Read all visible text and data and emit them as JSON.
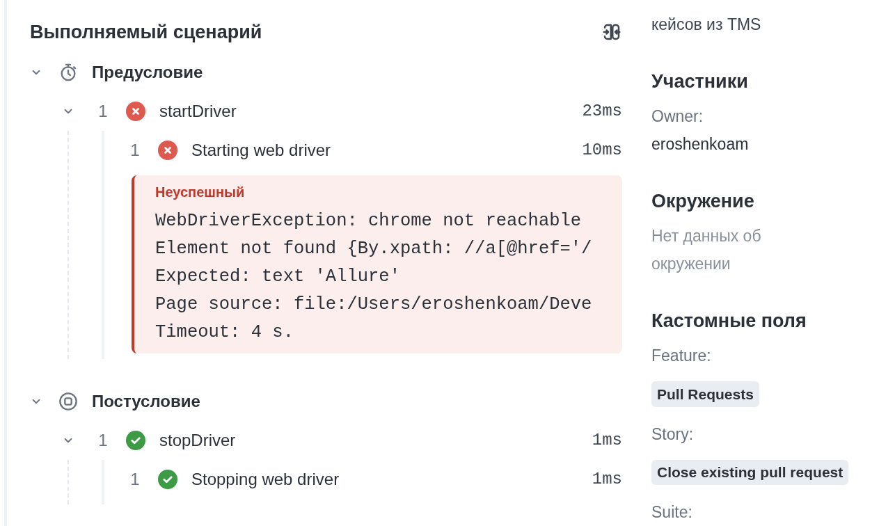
{
  "scenario": {
    "title": "Выполняемый сценарий",
    "sections": [
      {
        "kind": "setup",
        "label": "Предусловие",
        "expanded": true,
        "steps": [
          {
            "number": "1",
            "passed": false,
            "name": "startDriver",
            "duration": "23ms",
            "expanded": true,
            "children": [
              {
                "number": "1",
                "passed": false,
                "name": "Starting web driver",
                "duration": "10ms",
                "error": {
                  "title": "Неуспешный",
                  "lines": [
                    "WebDriverException: chrome not reachable",
                    "Element not found {By.xpath: //a[@href='/",
                    "Expected: text 'Allure'",
                    "Page source: file:/Users/eroshenkoam/Deve",
                    "Timeout: 4 s."
                  ]
                }
              }
            ]
          }
        ]
      },
      {
        "kind": "teardown",
        "label": "Постусловие",
        "expanded": true,
        "steps": [
          {
            "number": "1",
            "passed": true,
            "name": "stopDriver",
            "duration": "1ms",
            "expanded": true,
            "children": [
              {
                "number": "1",
                "passed": true,
                "name": "Stopping web driver",
                "duration": "1ms"
              }
            ]
          }
        ]
      }
    ]
  },
  "sidebar": {
    "links_text": "кейсов из TMS",
    "participants": {
      "title": "Участники",
      "label": "Owner:",
      "value": "eroshenkoam"
    },
    "environment": {
      "title": "Окружение",
      "empty_text": "Нет данных об окружении"
    },
    "custom_fields": {
      "title": "Кастомные поля",
      "fields": [
        {
          "label": "Feature:",
          "tag": "Pull Requests"
        },
        {
          "label": "Story:",
          "tag": "Close existing pull request"
        },
        {
          "label": "Suite:"
        }
      ]
    }
  }
}
